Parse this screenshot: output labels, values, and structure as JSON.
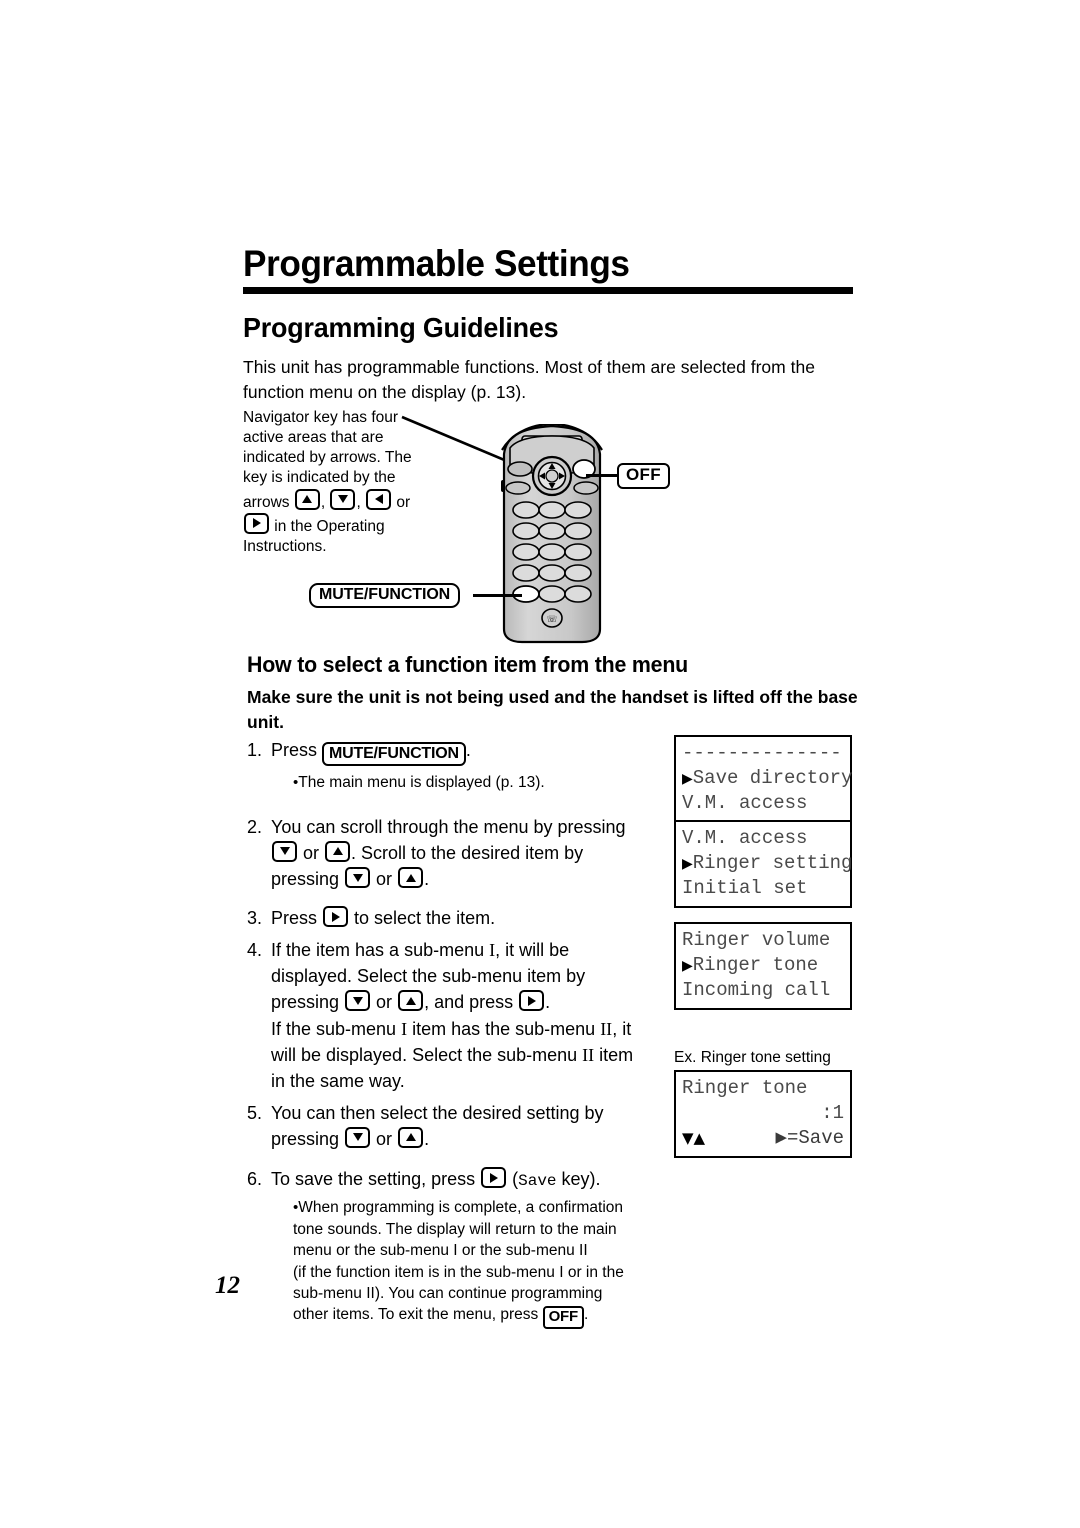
{
  "page": {
    "number": "12",
    "chapter_title": "Programmable Settings",
    "section_title": "Programming Guidelines",
    "intro": "This unit has programmable functions. Most of them are selected from the function menu on the display (p. 13)."
  },
  "navigator_note": {
    "lines": [
      "Navigator key has four",
      "active areas that are",
      "indicated by arrows. The",
      "key is indicated by the"
    ],
    "arrows_line_prefix": "arrows ",
    "arrows_line_suffix": " or",
    "arrows_line2_suffix": " in the Operating",
    "last_line": "Instructions."
  },
  "callouts": {
    "off": "OFF",
    "mute_function": "MUTE/FUNCTION"
  },
  "procedure": {
    "heading": "How to select a function item from the menu",
    "lead": "Make sure the unit is not being used and the handset is lifted off the base unit.",
    "steps": [
      {
        "num": "1.",
        "text_before": "Press ",
        "keycap": "MUTE/FUNCTION",
        "text_after": ".",
        "bullet": "The main menu is displayed (p. 13)."
      },
      {
        "num": "2.",
        "line1": "You can scroll through the menu by pressing",
        "line2_a": " or ",
        "line2_b": ". Scroll to the desired item by",
        "line3_a": "pressing ",
        "line3_b": " or ",
        "line3_c": "."
      },
      {
        "num": "3.",
        "text_before": "Press ",
        "text_after": " to select the item."
      },
      {
        "num": "4.",
        "l1_a": "If the item has a sub-menu ",
        "l1_roman": "I",
        "l1_b": ", it will be",
        "l2": "displayed. Select the sub-menu item by",
        "l3_a": "pressing ",
        "l3_b": " or ",
        "l3_c": ", and press ",
        "l3_d": ".",
        "l4_a": "If the sub-menu ",
        "l4_roman1": "I",
        "l4_b": " item has the sub-menu ",
        "l4_roman2": "II",
        "l4_c": ", it",
        "l5_a": "will be displayed. Select the sub-menu ",
        "l5_roman": "II",
        "l5_b": " item",
        "l6": "in the same way."
      },
      {
        "num": "5.",
        "l1": "You can then select the desired setting by",
        "l2_a": "pressing ",
        "l2_b": " or ",
        "l2_c": "."
      },
      {
        "num": "6.",
        "l1_a": "To save the setting, press ",
        "l1_b": " (",
        "l1_save": "Save",
        "l1_c": " key).",
        "bullet_lines": [
          "When programming is complete, a confirmation",
          "tone sounds. The display will return to the main",
          "menu or the sub-menu I or the sub-menu II",
          "(if the function item is in the sub-menu I or in the",
          "sub-menu II). You can continue programming",
          "other items. To exit the menu, press "
        ],
        "bullet_keycap": "OFF",
        "bullet_end": "."
      }
    ]
  },
  "displays": [
    {
      "name": "main-menu",
      "rows": [
        {
          "marker": "",
          "text": "--------------"
        },
        {
          "marker": "▶",
          "text": "Save directory"
        },
        {
          "marker": "",
          "text": "V.M. access"
        }
      ]
    },
    {
      "name": "main-menu-scrolled",
      "rows": [
        {
          "marker": "",
          "text": "V.M. access"
        },
        {
          "marker": "▶",
          "text": "Ringer setting"
        },
        {
          "marker": "",
          "text": "Initial set"
        }
      ]
    },
    {
      "name": "sub-menu-ringer",
      "rows": [
        {
          "marker": "",
          "text": "Ringer volume"
        },
        {
          "marker": "▶",
          "text": "Ringer tone"
        },
        {
          "marker": "",
          "text": "Incoming call"
        }
      ]
    },
    {
      "name": "ringer-tone-setting",
      "caption": "Ex. Ringer tone setting",
      "rows": [
        {
          "left": "Ringer tone",
          "right": ""
        },
        {
          "left": "",
          "right": ":1"
        },
        {
          "left": "▼▲",
          "right": "▶=Save"
        }
      ]
    }
  ]
}
